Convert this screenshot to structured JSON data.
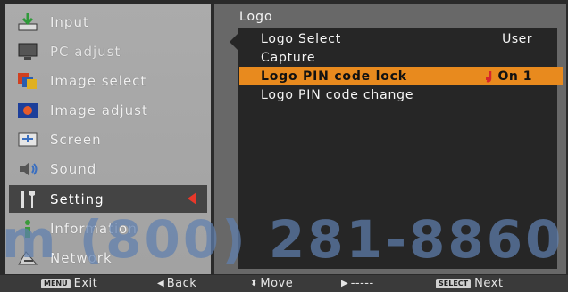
{
  "sidebar": {
    "items": [
      {
        "label": "Input",
        "icon": "input-arrow-icon"
      },
      {
        "label": "PC adjust",
        "icon": "monitor-icon"
      },
      {
        "label": "Image select",
        "icon": "image-select-icon"
      },
      {
        "label": "Image adjust",
        "icon": "image-adjust-icon"
      },
      {
        "label": "Screen",
        "icon": "screen-icon"
      },
      {
        "label": "Sound",
        "icon": "speaker-icon"
      },
      {
        "label": "Setting",
        "icon": "wrench-screwdriver-icon"
      },
      {
        "label": "Information",
        "icon": "info-icon"
      },
      {
        "label": "Network",
        "icon": "network-icon"
      }
    ],
    "active_index": 6
  },
  "panel": {
    "title": "Logo",
    "rows": [
      {
        "label": "Logo Select",
        "value": "User"
      },
      {
        "label": "Capture",
        "value": ""
      },
      {
        "label": "Logo PIN code lock",
        "value": "On 1"
      },
      {
        "label": "Logo PIN code change",
        "value": ""
      }
    ],
    "selected_index": 2
  },
  "footer": {
    "exit": {
      "key": "MENU",
      "label": "Exit"
    },
    "back": {
      "label": "Back"
    },
    "move": {
      "label": "Move"
    },
    "next_dash": {
      "label": "-----"
    },
    "next": {
      "key": "SELECT",
      "label": "Next"
    }
  },
  "watermark": "m (800) 281-8860",
  "colors": {
    "highlight": "#e88a1e",
    "chevron": "#e8382a",
    "lock": "#e8382a"
  }
}
